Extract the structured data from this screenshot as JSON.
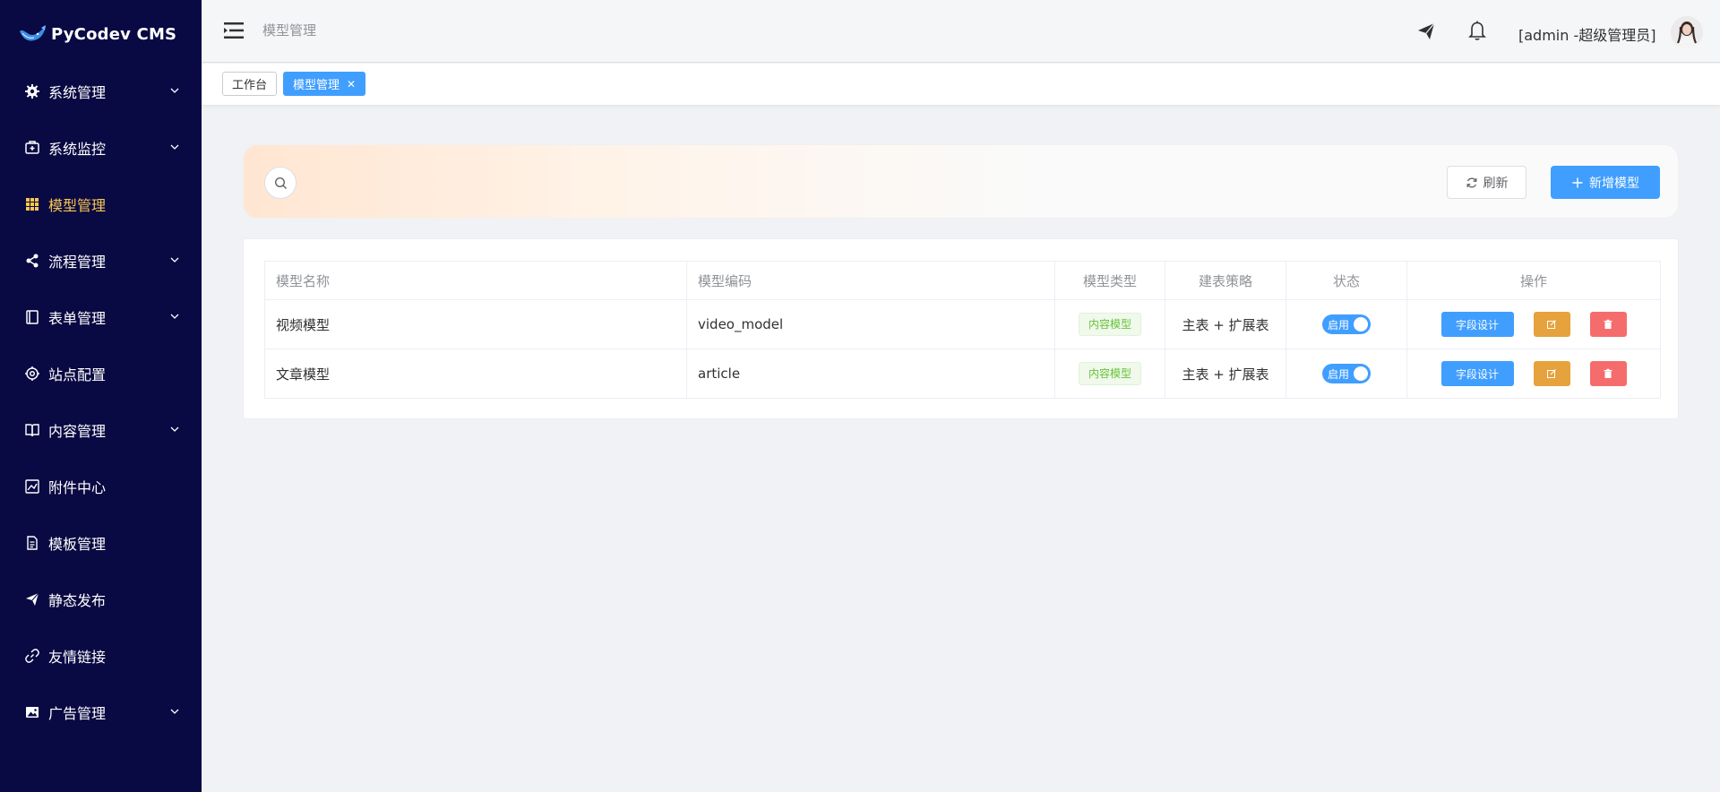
{
  "app": {
    "title": "PyCodev CMS"
  },
  "sidebar": {
    "items": [
      {
        "label": "系统管理",
        "icon": "gear-icon",
        "expandable": true,
        "active": false
      },
      {
        "label": "系统监控",
        "icon": "monitor-icon",
        "expandable": true,
        "active": false
      },
      {
        "label": "模型管理",
        "icon": "grid-icon",
        "expandable": false,
        "active": true
      },
      {
        "label": "流程管理",
        "icon": "share-icon",
        "expandable": true,
        "active": false
      },
      {
        "label": "表单管理",
        "icon": "form-icon",
        "expandable": true,
        "active": false
      },
      {
        "label": "站点配置",
        "icon": "settings-icon",
        "expandable": false,
        "active": false
      },
      {
        "label": "内容管理",
        "icon": "book-icon",
        "expandable": true,
        "active": false
      },
      {
        "label": "附件中心",
        "icon": "image-chart-icon",
        "expandable": false,
        "active": false
      },
      {
        "label": "模板管理",
        "icon": "document-icon",
        "expandable": false,
        "active": false
      },
      {
        "label": "静态发布",
        "icon": "paper-plane-icon",
        "expandable": false,
        "active": false
      },
      {
        "label": "友情链接",
        "icon": "link-icon",
        "expandable": false,
        "active": false
      },
      {
        "label": "广告管理",
        "icon": "picture-icon",
        "expandable": true,
        "active": false
      }
    ]
  },
  "header": {
    "breadcrumb": "模型管理",
    "user": "[admin -超级管理员]"
  },
  "tabs": [
    {
      "label": "工作台"
    },
    {
      "label": "模型管理",
      "close": "✕"
    }
  ],
  "toolbar": {
    "refresh_label": "刷新",
    "add_label": "新增模型"
  },
  "table": {
    "headers": [
      "模型名称",
      "模型编码",
      "模型类型",
      "建表策略",
      "状态",
      "操作"
    ],
    "rows": [
      {
        "name": "视频模型",
        "code": "video_model",
        "type": "内容模型",
        "strategy": "主表 + 扩展表",
        "status": "启用",
        "action_field": "字段设计"
      },
      {
        "name": "文章模型",
        "code": "article",
        "type": "内容模型",
        "strategy": "主表 + 扩展表",
        "status": "启用",
        "action_field": "字段设计"
      }
    ]
  },
  "colors": {
    "sidebar_bg": "#090943",
    "active_menu": "#f9c74f",
    "primary": "#409eff",
    "warning": "#e6a23c",
    "danger": "#f56c6c",
    "success": "#67c23a"
  }
}
